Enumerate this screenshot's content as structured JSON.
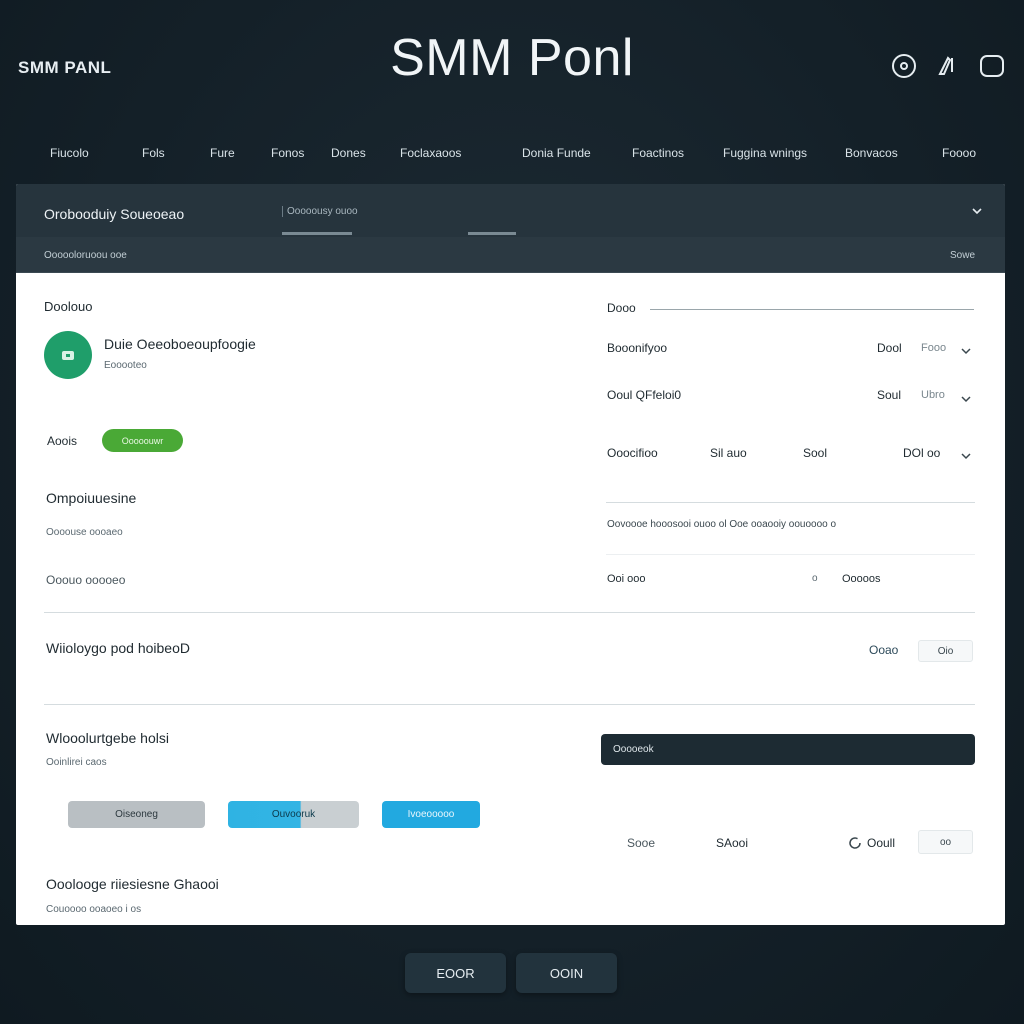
{
  "header": {
    "brand": "SMM PANL",
    "title": "SMM Ponl",
    "icons": [
      "clock-icon",
      "edit-icon",
      "tablet-icon"
    ]
  },
  "nav": {
    "items": [
      "Fiucolo",
      "Fols",
      "Fure",
      "Fonos",
      "Dones",
      "Foclaxaoos",
      "Donia Funde",
      "Foactinos",
      "Fuggina wnings",
      "Bonvacos",
      "Foooo"
    ]
  },
  "panel": {
    "title": "Orobooduiy Soueoeao",
    "search_placeholder": "Ooooousy ouoo",
    "subbar_left": "Oooooloruoou ooe",
    "subbar_right": "Sowe",
    "left": {
      "section_label": "Doolouo",
      "account_name": "Duie Oeeoboeoupfoogie",
      "account_sub": "Eooooteo",
      "status_label": "Aoois",
      "status_badge": "Ooooouwr",
      "group1_title": "Ompoiuuesine",
      "group1_sub": "Oooouse oooaeo",
      "group2_label": "Ooouo ooooeo",
      "wide_row_label": "Wiioloygo pod hoibeoD",
      "group3_title": "Wlooolurtgebe holsi",
      "group3_sub": "Ooinlirei caos",
      "btn_gray": "Oiseoneg",
      "btn_blue_grey": "Ouvooruk",
      "btn_blue": "Ivoeooooo",
      "group4_title": "Ooolooge riiesiesne Ghaooi",
      "group4_sub": "Couoooo ooaoeo i os"
    },
    "right": {
      "section_label": "Dooo",
      "row1_label": "Booonifyoo",
      "row1_value": "Dool",
      "row1_select": "Fooo",
      "row2_label": "Ooul QFfeloi0",
      "row2_value": "Soul",
      "row2_select": "Ubro",
      "row3_label": "Ooocifioo",
      "row3_a": "Sil auo",
      "row3_b": "Sool",
      "row3_select": "DOl oo",
      "note": "Oovoooe hooosooi ouoo ol Ooe ooaooiy oouoooo o",
      "row4_label": "Ooi ooo",
      "row4_sep": "o",
      "row4_value": "Ooooos",
      "wide_row_value": "Ooao",
      "wide_row_pill": "Oio",
      "dark_input": "Ooooeok",
      "bottom_a": "Sooe",
      "bottom_b": "SAooi",
      "bottom_c": "Ooull",
      "bottom_pill": "oo"
    }
  },
  "footer": {
    "btn1": "EOOR",
    "btn2": "OOIN"
  },
  "colors": {
    "background": "#142028",
    "panel_header": "#26343d",
    "badge_green": "#4aa936",
    "avatar": "#1f9e6a",
    "accent_blue": "#22a9e0"
  }
}
